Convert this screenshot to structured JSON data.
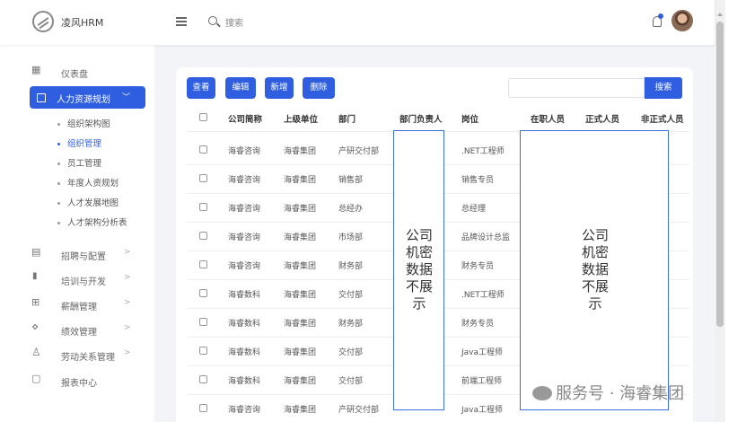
{
  "app": {
    "title": "凌风HRM"
  },
  "header": {
    "search_label": "搜索"
  },
  "sidebar": {
    "dashboard": "仪表盘",
    "hr_planning": "人力资源规划",
    "sub_items": [
      "组织架构图",
      "组织管理",
      "员工管理",
      "年度人资规划",
      "人才发展地图",
      "人才架构分析表"
    ],
    "active_sub": "组织管理",
    "groups": [
      {
        "label": "招聘与配置",
        "icon": "bars-icon"
      },
      {
        "label": "培训与开发",
        "icon": "chart-icon"
      },
      {
        "label": "薪酬管理",
        "icon": "grid-icon"
      },
      {
        "label": "绩效管理",
        "icon": "diamond-icon"
      },
      {
        "label": "劳动关系管理",
        "icon": "user-icon"
      },
      {
        "label": "报表中心",
        "icon": "doc-icon"
      }
    ]
  },
  "toolbar": {
    "view": "查看",
    "edit": "编辑",
    "add": "新增",
    "delete": "删除",
    "search": "搜索",
    "search_value": ""
  },
  "table": {
    "headers": [
      "公司简称",
      "上级单位",
      "部门",
      "部门负责人",
      "岗位",
      "在职人员",
      "正式人员",
      "非正式人员"
    ],
    "rows": [
      [
        "海睿咨询",
        "海睿集团",
        "产研交付部",
        ".NET工程师"
      ],
      [
        "海睿咨询",
        "海睿集团",
        "销售部",
        "销售专员"
      ],
      [
        "海睿咨询",
        "海睿集团",
        "总经办",
        "总经理"
      ],
      [
        "海睿咨询",
        "海睿集团",
        "市场部",
        "品牌设计总监"
      ],
      [
        "海睿咨询",
        "海睿集团",
        "财务部",
        "财务专员"
      ],
      [
        "海睿数科",
        "海睿集团",
        "交付部",
        ".NET工程师"
      ],
      [
        "海睿数科",
        "海睿集团",
        "财务部",
        "财务专员"
      ],
      [
        "海睿数科",
        "海睿集团",
        "交付部",
        "Java工程师"
      ],
      [
        "海睿数科",
        "海睿集团",
        "交付部",
        "前端工程师"
      ],
      [
        "海睿咨询",
        "海睿集团",
        "产研交付部",
        "Java工程师"
      ]
    ]
  },
  "overlay": {
    "left_lines": [
      "公司",
      "机密",
      "数据",
      "不展",
      "示"
    ],
    "right_lines": [
      "公司",
      "机密",
      "数据",
      "不展",
      "示"
    ]
  },
  "watermark": "服务号 · 海睿集团",
  "colors": {
    "accent": "#2f5fe0",
    "mask_border": "#3a6fd8"
  }
}
